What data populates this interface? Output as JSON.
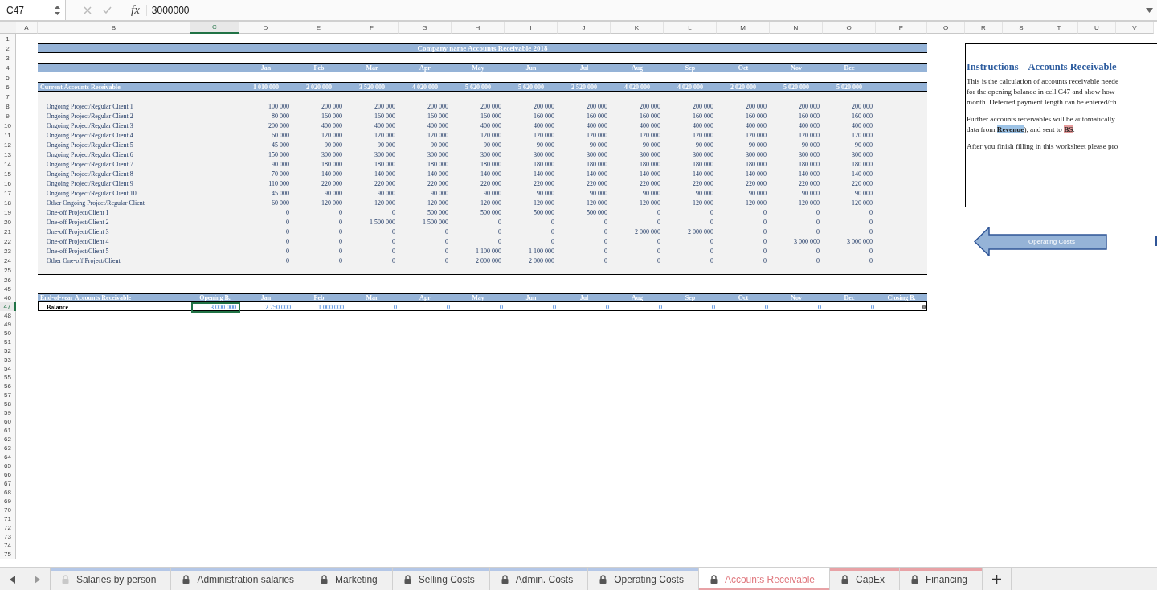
{
  "formula_bar": {
    "name_box": "C47",
    "fx_label": "fx",
    "formula": "3000000"
  },
  "columns": [
    {
      "label": "A",
      "selected": false
    },
    {
      "label": "B",
      "selected": false
    },
    {
      "label": "C",
      "selected": true
    },
    {
      "label": "D",
      "selected": false
    },
    {
      "label": "E",
      "selected": false
    },
    {
      "label": "F",
      "selected": false
    },
    {
      "label": "G",
      "selected": false
    },
    {
      "label": "H",
      "selected": false
    },
    {
      "label": "I",
      "selected": false
    },
    {
      "label": "J",
      "selected": false
    },
    {
      "label": "K",
      "selected": false
    },
    {
      "label": "L",
      "selected": false
    },
    {
      "label": "M",
      "selected": false
    },
    {
      "label": "N",
      "selected": false
    },
    {
      "label": "O",
      "selected": false
    },
    {
      "label": "P",
      "selected": false
    },
    {
      "label": "Q",
      "selected": false
    },
    {
      "label": "R",
      "selected": false
    },
    {
      "label": "S",
      "selected": false
    },
    {
      "label": "T",
      "selected": false
    },
    {
      "label": "U",
      "selected": false
    },
    {
      "label": "V",
      "selected": false
    }
  ],
  "rows": [
    {
      "label": "1",
      "selected": false
    },
    {
      "label": "2",
      "selected": false
    },
    {
      "label": "3",
      "selected": false
    },
    {
      "label": "4",
      "selected": false
    },
    {
      "label": "5",
      "selected": false
    },
    {
      "label": "6",
      "selected": false
    },
    {
      "label": "7",
      "selected": false
    },
    {
      "label": "8",
      "selected": false
    },
    {
      "label": "9",
      "selected": false
    },
    {
      "label": "10",
      "selected": false
    },
    {
      "label": "11",
      "selected": false
    },
    {
      "label": "12",
      "selected": false
    },
    {
      "label": "13",
      "selected": false
    },
    {
      "label": "14",
      "selected": false
    },
    {
      "label": "15",
      "selected": false
    },
    {
      "label": "16",
      "selected": false
    },
    {
      "label": "17",
      "selected": false
    },
    {
      "label": "18",
      "selected": false
    },
    {
      "label": "19",
      "selected": false
    },
    {
      "label": "20",
      "selected": false
    },
    {
      "label": "21",
      "selected": false
    },
    {
      "label": "22",
      "selected": false
    },
    {
      "label": "23",
      "selected": false
    },
    {
      "label": "24",
      "selected": false
    },
    {
      "label": "25",
      "selected": false
    },
    {
      "label": "26",
      "selected": false
    },
    {
      "label": "45",
      "selected": false
    },
    {
      "label": "46",
      "selected": false
    },
    {
      "label": "47",
      "selected": true
    },
    {
      "label": "48",
      "selected": false
    },
    {
      "label": "49",
      "selected": false
    },
    {
      "label": "50",
      "selected": false
    },
    {
      "label": "51",
      "selected": false
    },
    {
      "label": "52",
      "selected": false
    },
    {
      "label": "53",
      "selected": false
    },
    {
      "label": "54",
      "selected": false
    },
    {
      "label": "55",
      "selected": false
    },
    {
      "label": "56",
      "selected": false
    },
    {
      "label": "57",
      "selected": false
    },
    {
      "label": "58",
      "selected": false
    },
    {
      "label": "59",
      "selected": false
    },
    {
      "label": "60",
      "selected": false
    },
    {
      "label": "61",
      "selected": false
    },
    {
      "label": "62",
      "selected": false
    },
    {
      "label": "63",
      "selected": false
    },
    {
      "label": "64",
      "selected": false
    },
    {
      "label": "65",
      "selected": false
    },
    {
      "label": "66",
      "selected": false
    },
    {
      "label": "67",
      "selected": false
    },
    {
      "label": "68",
      "selected": false
    },
    {
      "label": "69",
      "selected": false
    },
    {
      "label": "70",
      "selected": false
    },
    {
      "label": "71",
      "selected": false
    },
    {
      "label": "72",
      "selected": false
    },
    {
      "label": "73",
      "selected": false
    },
    {
      "label": "74",
      "selected": false
    },
    {
      "label": "75",
      "selected": false
    }
  ],
  "title": "Company name Accounts Receivable 2018",
  "months": [
    "Jan",
    "Feb",
    "Mar",
    "Apr",
    "May",
    "Jun",
    "Jul",
    "Aug",
    "Sep",
    "Oct",
    "Nov",
    "Dec"
  ],
  "current": {
    "label": "Current Accounts Receivable",
    "totals": [
      "1 010 000",
      "2 020 000",
      "3 520 000",
      "4 020 000",
      "5 620 000",
      "5 620 000",
      "2 520 000",
      "4 020 000",
      "4 020 000",
      "2 020 000",
      "5 020 000",
      "5 020 000"
    ]
  },
  "items": [
    {
      "label": "Ongoing Project/Regular Client 1",
      "values": [
        "100 000",
        "200 000",
        "200 000",
        "200 000",
        "200 000",
        "200 000",
        "200 000",
        "200 000",
        "200 000",
        "200 000",
        "200 000",
        "200 000"
      ]
    },
    {
      "label": "Ongoing Project/Regular Client 2",
      "values": [
        "80 000",
        "160 000",
        "160 000",
        "160 000",
        "160 000",
        "160 000",
        "160 000",
        "160 000",
        "160 000",
        "160 000",
        "160 000",
        "160 000"
      ]
    },
    {
      "label": "Ongoing Project/Regular Client 3",
      "values": [
        "200 000",
        "400 000",
        "400 000",
        "400 000",
        "400 000",
        "400 000",
        "400 000",
        "400 000",
        "400 000",
        "400 000",
        "400 000",
        "400 000"
      ]
    },
    {
      "label": "Ongoing Project/Regular Client 4",
      "values": [
        "60 000",
        "120 000",
        "120 000",
        "120 000",
        "120 000",
        "120 000",
        "120 000",
        "120 000",
        "120 000",
        "120 000",
        "120 000",
        "120 000"
      ]
    },
    {
      "label": "Ongoing Project/Regular Client 5",
      "values": [
        "45 000",
        "90 000",
        "90 000",
        "90 000",
        "90 000",
        "90 000",
        "90 000",
        "90 000",
        "90 000",
        "90 000",
        "90 000",
        "90 000"
      ]
    },
    {
      "label": "Ongoing Project/Regular Client 6",
      "values": [
        "150 000",
        "300 000",
        "300 000",
        "300 000",
        "300 000",
        "300 000",
        "300 000",
        "300 000",
        "300 000",
        "300 000",
        "300 000",
        "300 000"
      ]
    },
    {
      "label": "Ongoing Project/Regular Client 7",
      "values": [
        "90 000",
        "180 000",
        "180 000",
        "180 000",
        "180 000",
        "180 000",
        "180 000",
        "180 000",
        "180 000",
        "180 000",
        "180 000",
        "180 000"
      ]
    },
    {
      "label": "Ongoing Project/Regular Client 8",
      "values": [
        "70 000",
        "140 000",
        "140 000",
        "140 000",
        "140 000",
        "140 000",
        "140 000",
        "140 000",
        "140 000",
        "140 000",
        "140 000",
        "140 000"
      ]
    },
    {
      "label": "Ongoing Project/Regular Client 9",
      "values": [
        "110 000",
        "220 000",
        "220 000",
        "220 000",
        "220 000",
        "220 000",
        "220 000",
        "220 000",
        "220 000",
        "220 000",
        "220 000",
        "220 000"
      ]
    },
    {
      "label": "Ongoing Project/Regular Client 10",
      "values": [
        "45 000",
        "90 000",
        "90 000",
        "90 000",
        "90 000",
        "90 000",
        "90 000",
        "90 000",
        "90 000",
        "90 000",
        "90 000",
        "90 000"
      ]
    },
    {
      "label": "Other Ongoing Project/Regular Client",
      "values": [
        "60 000",
        "120 000",
        "120 000",
        "120 000",
        "120 000",
        "120 000",
        "120 000",
        "120 000",
        "120 000",
        "120 000",
        "120 000",
        "120 000"
      ]
    },
    {
      "label": "One-off Project/Client 1",
      "values": [
        "0",
        "0",
        "0",
        "500 000",
        "500 000",
        "500 000",
        "500 000",
        "0",
        "0",
        "0",
        "0",
        "0"
      ]
    },
    {
      "label": "One-off Project/Client 2",
      "values": [
        "0",
        "0",
        "1 500 000",
        "1 500 000",
        "0",
        "0",
        "0",
        "0",
        "0",
        "0",
        "0",
        "0"
      ]
    },
    {
      "label": "One-off Project/Client 3",
      "values": [
        "0",
        "0",
        "0",
        "0",
        "0",
        "0",
        "0",
        "2 000 000",
        "2 000 000",
        "0",
        "0",
        "0"
      ]
    },
    {
      "label": "One-off Project/Client 4",
      "values": [
        "0",
        "0",
        "0",
        "0",
        "0",
        "0",
        "0",
        "0",
        "0",
        "0",
        "3 000 000",
        "3 000 000"
      ]
    },
    {
      "label": "One-off Project/Client 5",
      "values": [
        "0",
        "0",
        "0",
        "0",
        "1 100 000",
        "1 100 000",
        "0",
        "0",
        "0",
        "0",
        "0",
        "0"
      ]
    },
    {
      "label": "Other One-off Project/Client",
      "values": [
        "0",
        "0",
        "0",
        "0",
        "2 000 000",
        "2 000 000",
        "0",
        "0",
        "0",
        "0",
        "0",
        "0"
      ]
    }
  ],
  "end_of_year": {
    "label": "End-of-year Accounts Receivable",
    "headers": [
      "Opening B.",
      "Jan",
      "Feb",
      "Mar",
      "Apr",
      "May",
      "Jun",
      "Jul",
      "Aug",
      "Sep",
      "Oct",
      "Nov",
      "Dec",
      "Closing B."
    ],
    "balance_label": "Balance",
    "cells": [
      {
        "text": "3 000 000",
        "selected": true
      },
      {
        "text": "2 750 000",
        "selected": false
      },
      {
        "text": "1 000 000",
        "selected": false
      },
      {
        "text": "0",
        "selected": false
      },
      {
        "text": "0",
        "selected": false
      },
      {
        "text": "0",
        "selected": false
      },
      {
        "text": "0",
        "selected": false
      },
      {
        "text": "0",
        "selected": false
      },
      {
        "text": "0",
        "selected": false
      },
      {
        "text": "0",
        "selected": false
      },
      {
        "text": "0",
        "selected": false
      },
      {
        "text": "0",
        "selected": false
      },
      {
        "text": "0",
        "selected": false
      }
    ],
    "closing": "0"
  },
  "instructions": {
    "title": "Instructions – Accounts Receivable",
    "paragraphs": [
      [
        [
          {
            "text": "This is the calculation of accounts receivable neede"
          }
        ],
        [
          {
            "text": "for the opening balance in cell C47 and show how"
          }
        ],
        [
          {
            "text": "month. Deferred payment length can be entered/ch"
          }
        ]
      ],
      [
        [
          {
            "text": "Further accounts receivables will be automatically"
          }
        ],
        [
          {
            "text": "data from "
          },
          {
            "text": "Revenue",
            "color": "#9dc3e6"
          },
          {
            "text": "), and sent to "
          },
          {
            "text": "BS",
            "color": "#e59a9a"
          },
          {
            "text": "."
          }
        ]
      ],
      [
        [
          {
            "text": "After you finish filling in this worksheet please pro"
          }
        ]
      ]
    ]
  },
  "nav_button": "Operating Costs",
  "tabs": [
    {
      "label": "Salaries by person",
      "selected": false,
      "color": "#b4c7e7"
    },
    {
      "label": "Administration salaries",
      "selected": false,
      "color": "#b4c7e7"
    },
    {
      "label": "Marketing",
      "selected": false,
      "color": "#b4c7e7"
    },
    {
      "label": "Selling Costs",
      "selected": false,
      "color": "#b4c7e7"
    },
    {
      "label": "Admin. Costs",
      "selected": false,
      "color": "#b4c7e7"
    },
    {
      "label": "Operating Costs",
      "selected": false,
      "color": "#b4c7e7"
    },
    {
      "label": "Accounts Receivable",
      "selected": true,
      "color": "#e8a2a6"
    },
    {
      "label": "CapEx",
      "selected": false,
      "color": "#e8a2a6"
    },
    {
      "label": "Financing",
      "selected": false,
      "color": "#e8a2a6"
    }
  ]
}
